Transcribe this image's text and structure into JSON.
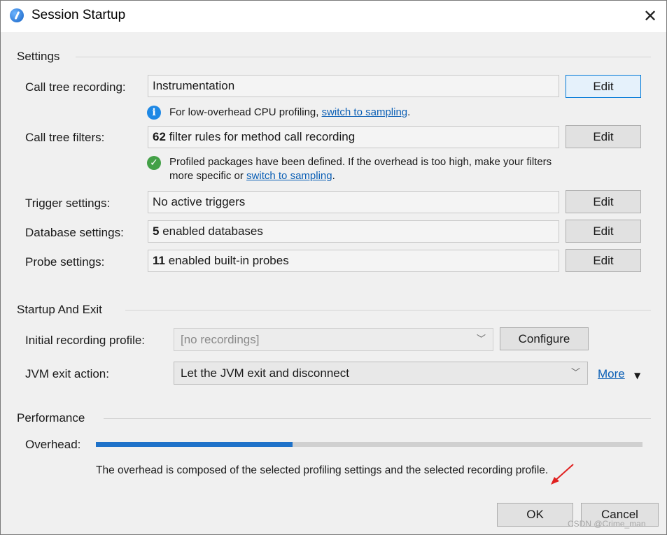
{
  "window": {
    "title": "Session Startup",
    "close_symbol": "✕"
  },
  "icons": {
    "app": "jprofiler-app-icon",
    "info": "info-icon",
    "check": "check-circle-icon",
    "close": "close-icon",
    "chevron": "chevron-down-icon",
    "red_arrow": "red-arrow-annotation"
  },
  "colors": {
    "accent": "#0078d7",
    "link": "#0b5fb5",
    "progress": "#1f72c9",
    "success": "#43a047",
    "info": "#1e88e5",
    "annotation": "#e0201f"
  },
  "settings": {
    "section_title": "Settings",
    "call_tree_recording": {
      "label": "Call tree recording:",
      "value": "Instrumentation",
      "edit": "Edit"
    },
    "cpu_note": {
      "text": "For low-overhead CPU profiling, ",
      "link": "switch to sampling",
      "suffix": "."
    },
    "call_tree_filters": {
      "label": "Call tree filters:",
      "count": "62",
      "value": " filter rules for method call recording",
      "edit": "Edit"
    },
    "filters_note": {
      "line1": "Profiled packages have been defined. If the overhead is too high, make your filters",
      "line2": "more specific or ",
      "link": "switch to sampling",
      "suffix": "."
    },
    "trigger_settings": {
      "label": "Trigger settings:",
      "value": "No active triggers",
      "edit": "Edit"
    },
    "database_settings": {
      "label": "Database settings:",
      "count": "5",
      "value": " enabled databases",
      "edit": "Edit"
    },
    "probe_settings": {
      "label": "Probe settings:",
      "count": "11",
      "value": " enabled built-in probes",
      "edit": "Edit"
    }
  },
  "startup": {
    "section_title": "Startup And Exit",
    "initial_profile": {
      "label": "Initial recording profile:",
      "value": "[no recordings]",
      "configure": "Configure"
    },
    "jvm_exit": {
      "label": "JVM exit action:",
      "value": "Let the JVM exit and disconnect",
      "more": "More",
      "more_arrow": "▼"
    }
  },
  "performance": {
    "section_title": "Performance",
    "overhead_label": "Overhead:",
    "overhead_fraction": 0.36,
    "description": "The overhead is composed of the selected profiling settings and the selected recording profile."
  },
  "footer": {
    "ok": "OK",
    "cancel": "Cancel",
    "watermark": "CSDN @Crime_man"
  }
}
